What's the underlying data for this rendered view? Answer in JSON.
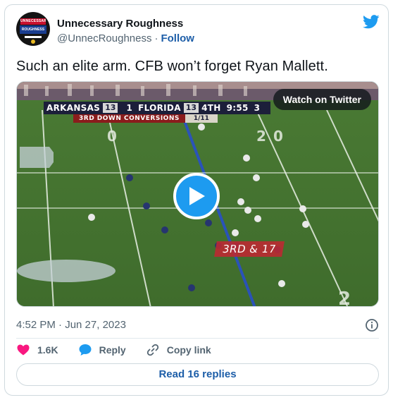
{
  "author": {
    "display_name": "Unnecessary Roughness",
    "handle": "@UnnecRoughness",
    "separator": "·",
    "follow_label": "Follow",
    "avatar_text_top": "UNNECESSARY",
    "avatar_text_mid": "ROUGHNESS"
  },
  "tweet": {
    "text": "Such an elite arm. CFB won’t forget Ryan Mallett.",
    "timestamp": "4:52 PM · Jun 27, 2023"
  },
  "video": {
    "watch_label": "Watch on Twitter",
    "scorebug": {
      "team1": "ARKANSAS",
      "team1_rank": "13",
      "team2_rank_prefix": "1",
      "team2": "FLORIDA",
      "team2_score": "13",
      "quarter": "4TH",
      "clock": "9:55",
      "extra": "3",
      "stat_label": "3RD DOWN CONVERSIONS",
      "stat_value": "1/11"
    },
    "down_distance": "3RD & 17",
    "field_numbers": [
      "0",
      "2",
      "0",
      "2"
    ]
  },
  "actions": {
    "like_count": "1.6K",
    "reply_label": "Reply",
    "copy_label": "Copy link",
    "read_replies_label": "Read 16 replies"
  },
  "colors": {
    "like": "#f91880",
    "reply": "#1d9bf0",
    "link": "#1d5ea8",
    "brand": "#1d9bf0"
  },
  "icons": {
    "brand": "twitter-bird-icon",
    "like": "heart-icon",
    "reply": "speech-bubble-icon",
    "copy": "link-icon",
    "info": "info-icon",
    "play": "play-icon"
  }
}
